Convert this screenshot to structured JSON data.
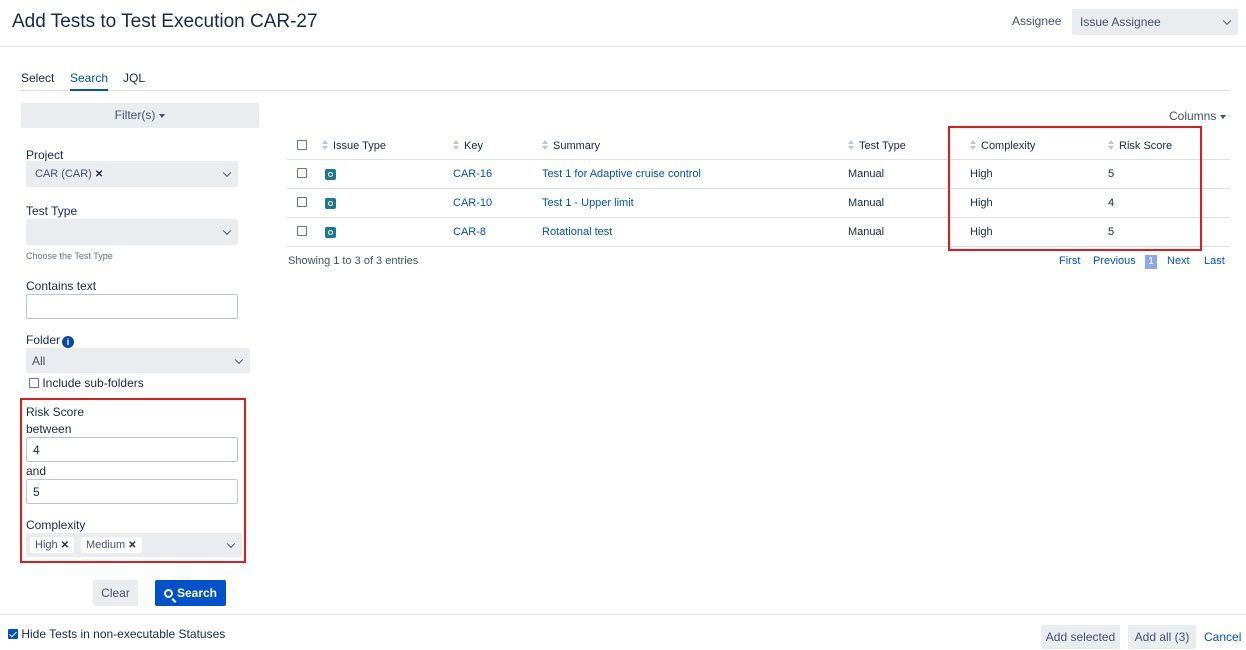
{
  "header": {
    "title": "Add Tests to Test Execution CAR-27",
    "assignee_label": "Assignee",
    "assignee_value": "Issue Assignee"
  },
  "tabs": [
    {
      "label": "Select",
      "active": false
    },
    {
      "label": "Search",
      "active": true
    },
    {
      "label": "JQL",
      "active": false
    }
  ],
  "filters": {
    "filter_button": "Filter(s)",
    "project_label": "Project",
    "project_chip": "CAR (CAR)",
    "test_type_label": "Test Type",
    "test_type_hint": "Choose the Test Type",
    "contains_text_label": "Contains text",
    "contains_text_value": "",
    "folder_label": "Folder",
    "folder_value": "All",
    "include_subfolders_label": "Include sub-folders",
    "risk_score_label": "Risk Score",
    "between_label": "between",
    "between_value": "4",
    "and_label": "and",
    "and_value": "5",
    "complexity_label": "Complexity",
    "complexity_chips": [
      "High",
      "Medium"
    ],
    "clear_button": "Clear",
    "search_button": "Search"
  },
  "table": {
    "columns_button": "Columns",
    "headers": [
      "Issue Type",
      "Key",
      "Summary",
      "Test Type",
      "Complexity",
      "Risk Score"
    ],
    "rows": [
      {
        "key": "CAR-16",
        "summary": "Test 1 for Adaptive cruise control",
        "test_type": "Manual",
        "complexity": "High",
        "risk_score": "5"
      },
      {
        "key": "CAR-10",
        "summary": "Test 1 - Upper limit",
        "test_type": "Manual",
        "complexity": "High",
        "risk_score": "4"
      },
      {
        "key": "CAR-8",
        "summary": "Rotational test",
        "test_type": "Manual",
        "complexity": "High",
        "risk_score": "5"
      }
    ],
    "showing": "Showing 1 to 3 of 3 entries",
    "pager": {
      "first": "First",
      "previous": "Previous",
      "current": "1",
      "next": "Next",
      "last": "Last"
    }
  },
  "footer": {
    "hide_tests_label": "Hide Tests in non-executable Statuses",
    "add_selected": "Add selected",
    "add_all": "Add all (3)",
    "cancel": "Cancel"
  },
  "colors": {
    "accent": "#0052cc",
    "highlight": "#e01b1b"
  }
}
